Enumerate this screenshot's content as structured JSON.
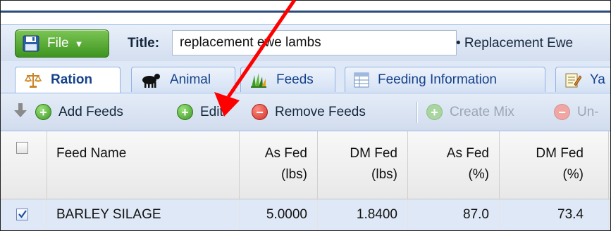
{
  "titlebar": {
    "file_label": "File",
    "title_label": "Title:",
    "title_value": "replacement ewe lambs",
    "description": "• Replacement Ewe"
  },
  "tabs": [
    {
      "label": "Ration",
      "icon": "scale-icon",
      "active": true
    },
    {
      "label": "Animal",
      "icon": "sheep-icon",
      "active": false
    },
    {
      "label": "Feeds",
      "icon": "grass-icon",
      "active": false
    },
    {
      "label": "Feeding Information",
      "icon": "table-icon",
      "active": false
    },
    {
      "label": "Ya",
      "icon": "notepad-icon",
      "active": false
    }
  ],
  "toolbar": {
    "add_feeds": "Add Feeds",
    "edit": "Edit",
    "remove_feeds": "Remove Feeds",
    "create_mix": "Create Mix",
    "unmix": "Un-"
  },
  "grid": {
    "columns": {
      "feed_name": "Feed Name",
      "as_fed_lbs": [
        "As Fed",
        "(lbs)"
      ],
      "dm_fed_lbs": [
        "DM Fed",
        "(lbs)"
      ],
      "as_fed_pct": [
        "As Fed",
        "(%)"
      ],
      "dm_fed_pct": [
        "DM Fed",
        "(%)"
      ]
    },
    "rows": [
      {
        "checked": true,
        "feed_name": "BARLEY SILAGE",
        "as_fed_lbs": "5.0000",
        "dm_fed_lbs": "1.8400",
        "as_fed_pct": "87.0",
        "dm_fed_pct": "73.4"
      }
    ]
  },
  "colors": {
    "file_button": "#4ea52a",
    "annotation_arrow": "#ff0000",
    "tab_text": "#15428b",
    "selected_row": "#dfe8f6"
  }
}
